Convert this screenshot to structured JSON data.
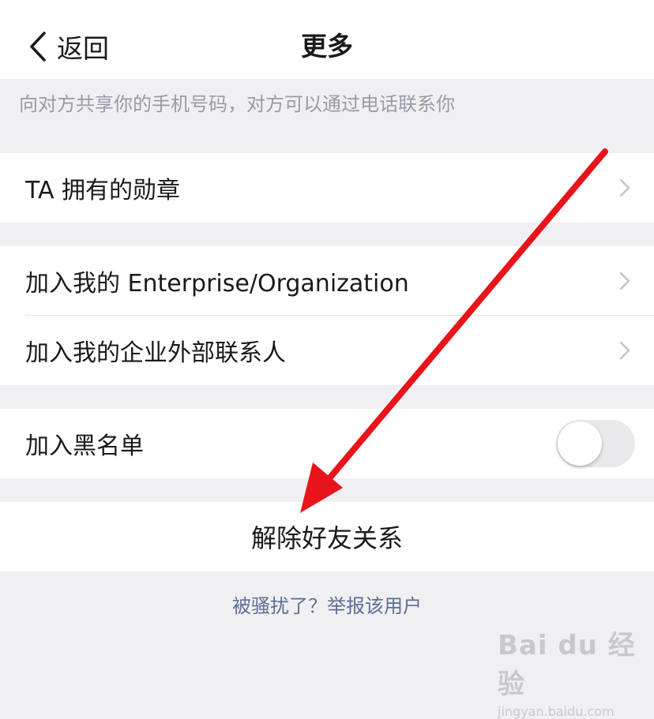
{
  "nav": {
    "back_label": "返回",
    "title": "更多"
  },
  "hint": "向对方共享你的手机号码，对方可以通过电话联系你",
  "rows": {
    "medals": "TA 拥有的勋章",
    "join_enterprise": "加入我的 Enterprise/Organization",
    "join_external": "加入我的企业外部联系人",
    "blacklist": "加入黑名单"
  },
  "blacklist_toggle": {
    "on": false
  },
  "remove_friend": "解除好友关系",
  "report": "被骚扰了？举报该用户",
  "watermark": {
    "main": "Bai du 经验",
    "sub": "jingyan.baidu.com"
  },
  "colors": {
    "background": "#f0f0f3",
    "link": "#5b6e93",
    "annotation_arrow": "#e8141b"
  }
}
